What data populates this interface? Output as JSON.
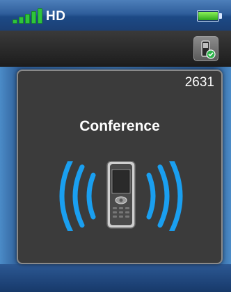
{
  "status_bar": {
    "quality_label": "HD",
    "signal_icon": "signal-strength-icon",
    "battery_icon": "battery-full-icon",
    "signal_color": "#2ec43c",
    "battery_color": "#5fd03a"
  },
  "toolbar": {
    "button_icon": "phone-status-icon"
  },
  "call_panel": {
    "extension": "2631",
    "title": "Conference",
    "graphic_icon": "ringing-phone-icon",
    "wave_color": "#1a9ff0"
  }
}
